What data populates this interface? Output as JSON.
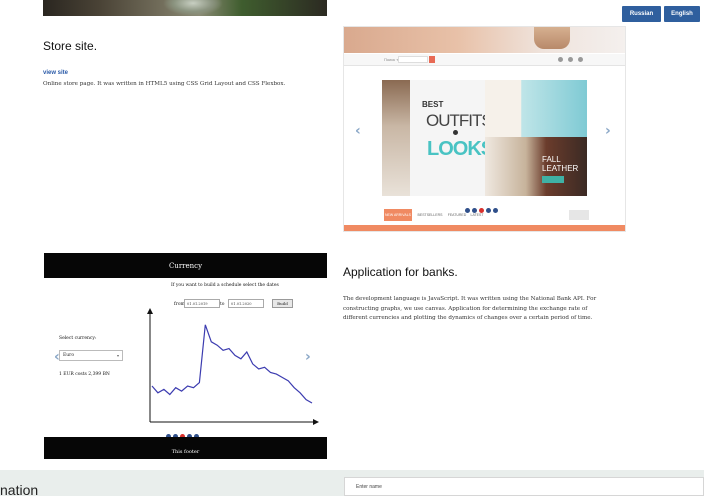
{
  "header": {
    "lang_buttons": [
      "Russian",
      "English"
    ]
  },
  "projects": [
    {
      "title": "Store site.",
      "link": "view site",
      "description": "Online store page. It was written in HTML5 using CSS Grid Layout and CSS Flexbox."
    },
    {
      "title": "Application for banks.",
      "description_lines": [
        "The development language is JavaScript. It was written using the National Bank API. For",
        "constructing graphs, we use canvas. Application for determining the exchange rate of",
        "different currencies and plotting the dynamics of changes over a certain period of time."
      ]
    }
  ],
  "store_preview": {
    "search_label": "Поиск товара",
    "banner_words": [
      "BEST",
      "OUTFITS",
      "LOOKS",
      "FALL",
      "LEATHER"
    ],
    "tabs": [
      "NEW ARRIVALS",
      "BESTSELLERS",
      "FEATURED",
      "LATEST"
    ]
  },
  "currency_app": {
    "title": "Currency",
    "prompt": "If you want to build a schedule select the dates",
    "from_label": "from",
    "to_label": "to",
    "from_value": "01.01.2019",
    "to_value": "01.01.2020",
    "build_label": "Build",
    "select_label": "Select currency:",
    "selected_currency": "Euro",
    "rate_text": "1 EUR costs 2,399 BN",
    "footer": "This footer",
    "line_values": [
      0.2,
      0.16,
      0.18,
      0.15,
      0.19,
      0.17,
      0.2,
      0.19,
      0.22,
      0.56,
      0.46,
      0.44,
      0.41,
      0.42,
      0.38,
      0.36,
      0.4,
      0.33,
      0.3,
      0.31,
      0.28,
      0.27,
      0.25,
      0.23,
      0.19,
      0.16,
      0.12,
      0.1
    ]
  },
  "bottom": {
    "section_title": "nation",
    "name_placeholder": "Enter name"
  },
  "colors": {
    "lang_button": "#2f5f9e",
    "store_accent": "#f08a62",
    "chart_line": "#3c3cb0",
    "link": "#2a5aa8"
  }
}
